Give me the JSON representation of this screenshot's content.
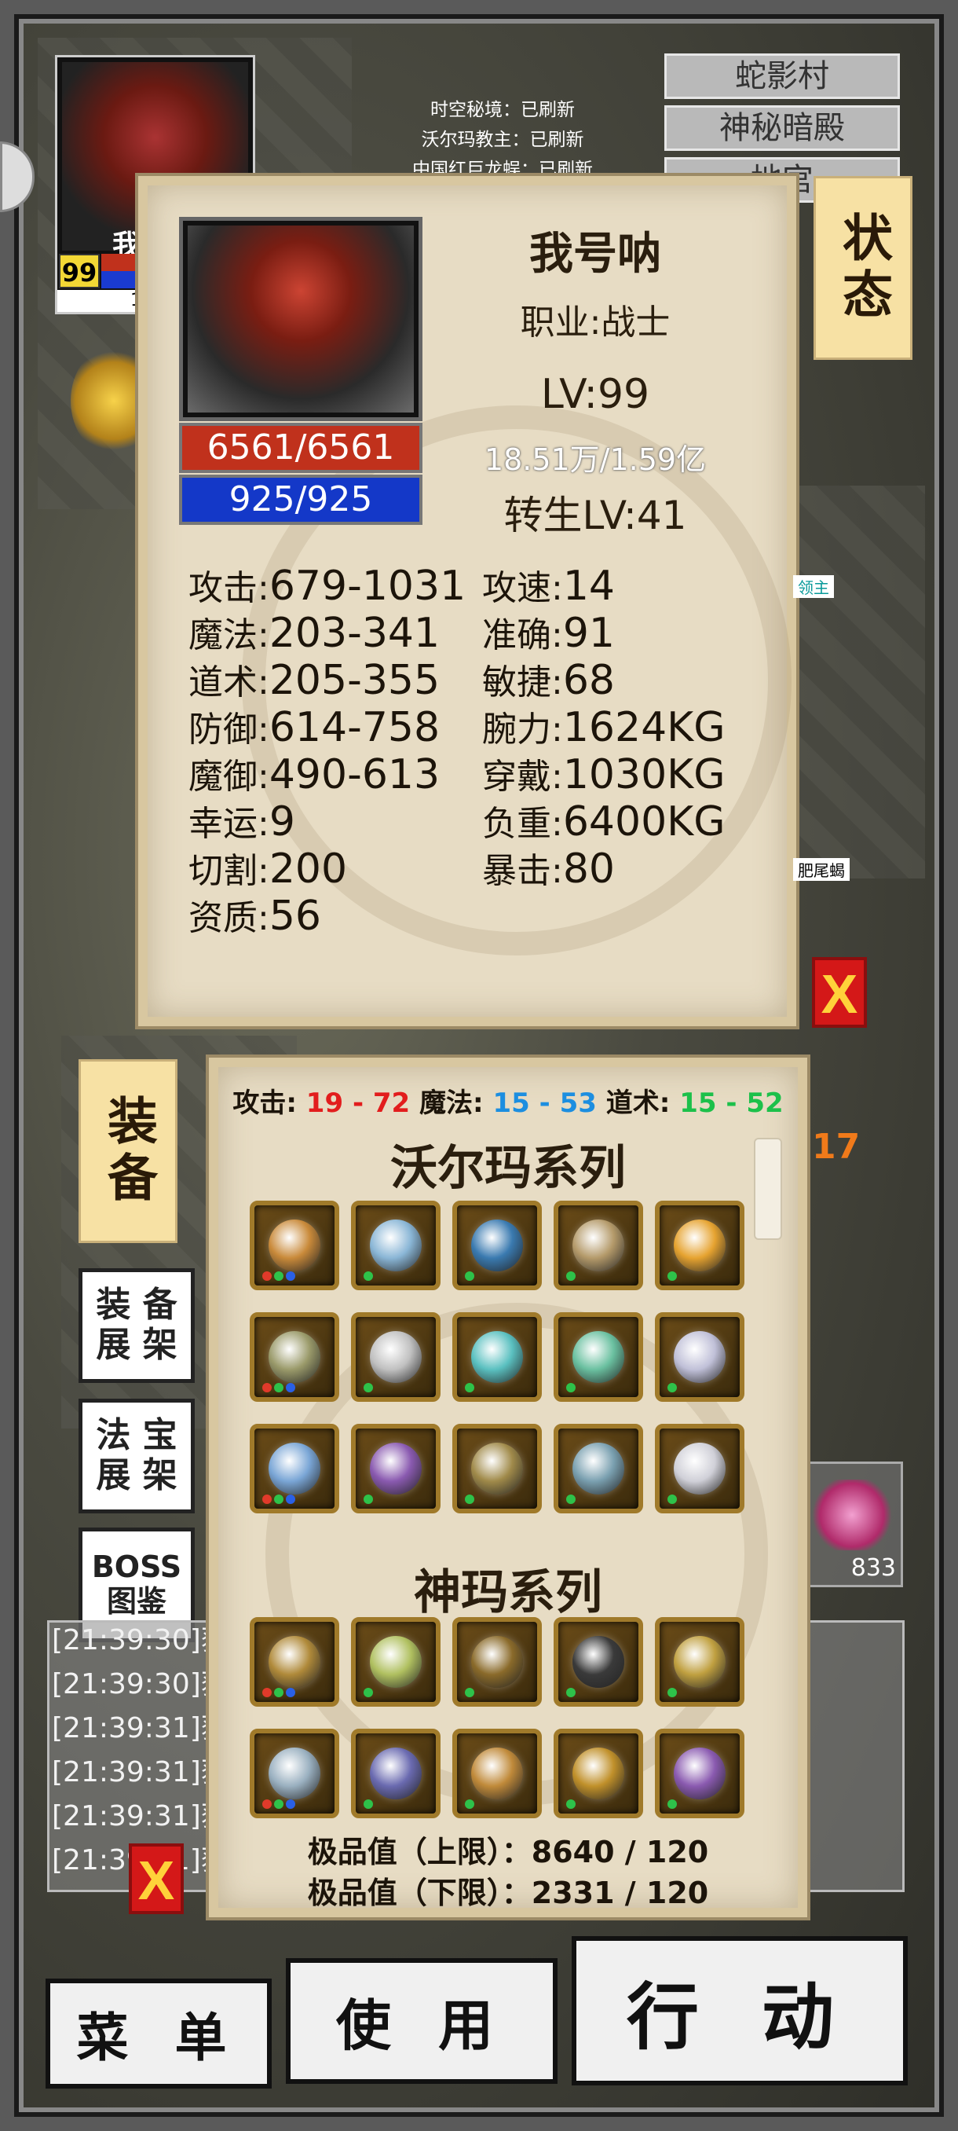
{
  "top_left": {
    "level": "99",
    "name_fragment": "我",
    "exp_fragment": "18.51"
  },
  "notices": [
    "时空秘境：已刷新",
    "沃尔玛教主：已刷新",
    "中国红巨龙蜈：已刷新"
  ],
  "locations": [
    "蛇影村",
    "神秘暗殿",
    "地宫"
  ],
  "side_tabs": {
    "status": "状态",
    "equipment": "装备"
  },
  "side_buttons": {
    "equip_shelf": "装 备 展 架",
    "treasure_shelf": "法 宝 展 架",
    "boss_guide": "BOSS 图鉴"
  },
  "map_labels": {
    "label1": "领主",
    "label2": "肥尾蝎",
    "number_badge": "17",
    "item_count": "833"
  },
  "close_icon": "X",
  "status": {
    "name": "我号呐",
    "job": "职业:战士",
    "level_label": "LV:",
    "level": "99",
    "exp": "18.51万/1.59亿",
    "rebirth_label": "转生LV:",
    "rebirth": "41",
    "hp": "6561/6561",
    "mp": "925/925",
    "stats_left": [
      {
        "k": "攻击:",
        "v": "679-1031"
      },
      {
        "k": "魔法:",
        "v": "203-341"
      },
      {
        "k": "道术:",
        "v": "205-355"
      },
      {
        "k": "防御:",
        "v": "614-758"
      },
      {
        "k": "魔御:",
        "v": "490-613"
      },
      {
        "k": "幸运:",
        "v": "9"
      },
      {
        "k": "切割:",
        "v": "200"
      },
      {
        "k": "资质:",
        "v": "56"
      }
    ],
    "stats_right": [
      {
        "k": "攻速:",
        "v": "14"
      },
      {
        "k": "准确:",
        "v": "91"
      },
      {
        "k": "敏捷:",
        "v": "68"
      },
      {
        "k": "腕力:",
        "v": "1624KG"
      },
      {
        "k": "穿戴:",
        "v": "1030KG"
      },
      {
        "k": "负重:",
        "v": "6400KG"
      },
      {
        "k": "暴击:",
        "v": "80"
      }
    ]
  },
  "equipment": {
    "atk_label": "攻击:",
    "atk": "19 - 72",
    "mag_label": "魔法:",
    "mag": "15 - 53",
    "tao_label": "道术:",
    "tao": "15 - 52",
    "series1": "沃尔玛系列",
    "series2": "神玛系列",
    "quality_upper": "极品值（上限）：8640 / 120",
    "quality_lower": "极品值（下限）：2331 / 120",
    "item_colors": [
      "#c98a3a",
      "#8ab6d6",
      "#3a7ab0",
      "#b49a6a",
      "#e6a330",
      "#9a9a6a",
      "#c0c0c0",
      "#5ac0c0",
      "#6ac0a0",
      "#c0c0d8",
      "#7aa6d6",
      "#8a5ab0",
      "#a08a4a",
      "#7aa0b0",
      "#d0d0d8",
      "#b08a3a",
      "#b0c060",
      "#8a6a2a",
      "#3a3a3a",
      "#c0a040",
      "#9ab0c0",
      "#6a6ab0",
      "#c08a3a",
      "#c0902a",
      "#8a5ab0"
    ]
  },
  "log_lines": [
    "[21:39:30]获",
    "[21:39:30]获",
    "[21:39:31]获",
    "[21:39:31]获",
    "[21:39:31]获",
    "[21:39:31]获"
  ],
  "bottom": {
    "menu": "菜 单",
    "use": "使 用",
    "action": "行 动"
  }
}
